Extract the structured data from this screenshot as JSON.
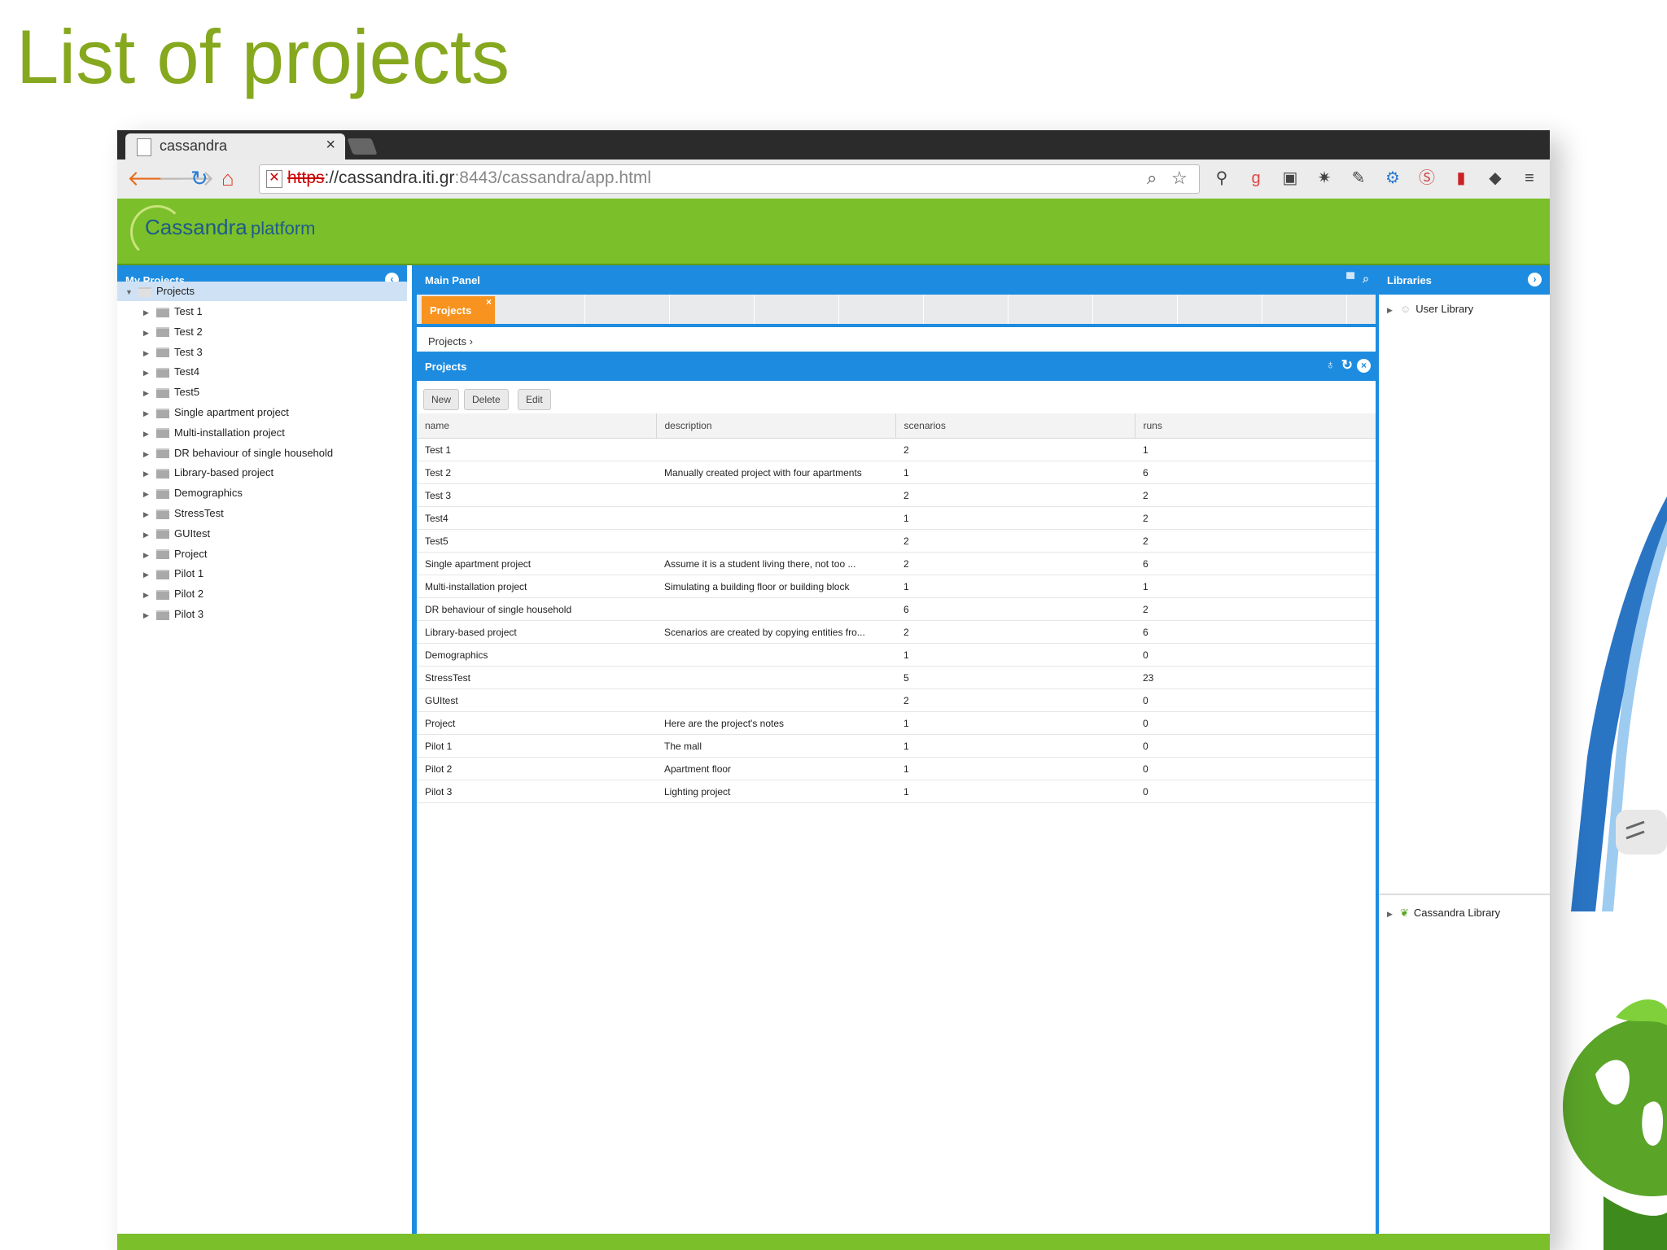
{
  "slide": {
    "title": "List of projects"
  },
  "browser": {
    "tab_title": "cassandra",
    "tab_close": "×",
    "url_scheme": "https",
    "url_rest": "://cassandra.iti.gr",
    "url_port_path": ":8443/cassandra/app.html"
  },
  "app": {
    "logo": "Cassandra",
    "platform": "platform"
  },
  "my_projects": {
    "title": "My Projects",
    "root": "Projects",
    "items": [
      "Test 1",
      "Test 2",
      "Test 3",
      "Test4",
      "Test5",
      "Single apartment project",
      "Multi-installation project",
      "DR behaviour of single household",
      "Library-based project",
      "Demographics",
      "StressTest",
      "GUItest",
      "Project",
      "Pilot 1",
      "Pilot 2",
      "Pilot 3"
    ]
  },
  "main_panel": {
    "title": "Main Panel",
    "tab_label": "Projects",
    "tab_close": "×",
    "breadcrumb": "Projects ›",
    "grid_title": "Projects",
    "buttons": {
      "new": "New",
      "delete": "Delete",
      "edit": "Edit"
    },
    "columns": [
      "name",
      "description",
      "scenarios",
      "runs"
    ],
    "rows": [
      [
        "Test 1",
        "",
        "2",
        "1"
      ],
      [
        "Test 2",
        "Manually created project with four apartments",
        "1",
        "6"
      ],
      [
        "Test 3",
        "",
        "2",
        "2"
      ],
      [
        "Test4",
        "",
        "1",
        "2"
      ],
      [
        "Test5",
        "",
        "2",
        "2"
      ],
      [
        "Single apartment project",
        "Assume it is a student living there, not too ...",
        "2",
        "6"
      ],
      [
        "Multi-installation project",
        "Simulating a building floor or building block",
        "1",
        "1"
      ],
      [
        "DR behaviour of single household",
        "",
        "6",
        "2"
      ],
      [
        "Library-based project",
        "Scenarios are created by copying entities fro...",
        "2",
        "6"
      ],
      [
        "Demographics",
        "",
        "1",
        "0"
      ],
      [
        "StressTest",
        "",
        "5",
        "23"
      ],
      [
        "GUItest",
        "",
        "2",
        "0"
      ],
      [
        "Project",
        "Here are the project's notes",
        "1",
        "0"
      ],
      [
        "Pilot 1",
        "The mall",
        "1",
        "0"
      ],
      [
        "Pilot 2",
        "Apartment floor",
        "1",
        "0"
      ],
      [
        "Pilot 3",
        "Lighting project",
        "1",
        "0"
      ]
    ]
  },
  "libraries": {
    "title": "Libraries",
    "user_library": "User Library",
    "cassandra_library": "Cassandra Library"
  },
  "colors": {
    "slide_title": "#86a81e",
    "app_header": "#7bbf2a",
    "panel_blue": "#1d8ce0",
    "tab_orange": "#f7931e"
  }
}
